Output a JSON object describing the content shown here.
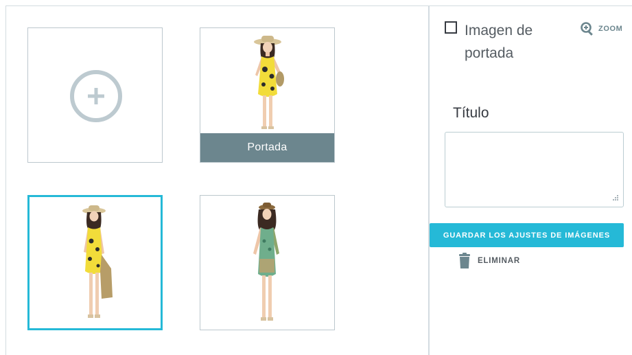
{
  "gallery": {
    "add_tile": {
      "icon": "plus-circle-icon"
    },
    "images": [
      {
        "cover_label": "Portada",
        "dress": "yellow-floral-dress",
        "selected": false
      },
      {
        "dress": "yellow-floral-dress-with-bag",
        "selected": true
      },
      {
        "dress": "green-patterned-dress",
        "selected": false
      }
    ]
  },
  "settings": {
    "cover_checkbox_label": "Imagen de portada",
    "zoom_label": "ZOOM",
    "title_label": "Título",
    "title_value": "",
    "save_button_label": "GUARDAR LOS AJUSTES DE IMÁGENES",
    "delete_label": "ELIMINAR"
  },
  "colors": {
    "accent": "#25b9d7",
    "cover_bar": "#6c868e",
    "border": "#bcc7cd"
  }
}
